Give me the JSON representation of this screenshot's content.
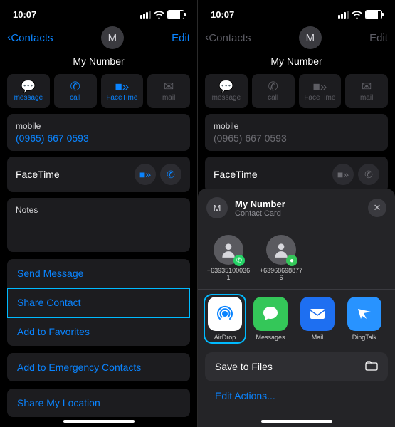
{
  "left": {
    "status_time": "10:07",
    "nav": {
      "back": "Contacts",
      "avatar_letter": "M",
      "edit": "Edit"
    },
    "contact_name": "My Number",
    "actions": {
      "message": "message",
      "call": "call",
      "facetime": "FaceTime",
      "mail": "mail"
    },
    "mobile": {
      "label": "mobile",
      "value": "(0965) 667 0593"
    },
    "facetime_label": "FaceTime",
    "notes_label": "Notes",
    "links1": {
      "send_message": "Send Message",
      "share_contact": "Share Contact",
      "add_favorites": "Add to Favorites"
    },
    "links2": {
      "add_emergency": "Add to Emergency Contacts"
    },
    "links3": {
      "share_location": "Share My Location"
    }
  },
  "right": {
    "status_time": "10:07",
    "nav": {
      "back": "Contacts",
      "avatar_letter": "M",
      "edit": "Edit"
    },
    "contact_name": "My Number",
    "actions": {
      "message": "message",
      "call": "call",
      "facetime": "FaceTime",
      "mail": "mail"
    },
    "mobile": {
      "label": "mobile",
      "value": "(0965) 667 0593"
    },
    "facetime_label": "FaceTime",
    "sheet": {
      "avatar_letter": "M",
      "title": "My Number",
      "subtitle": "Contact Card",
      "people": [
        {
          "number": "+639351000361"
        },
        {
          "number": "+639686988776"
        }
      ],
      "apps": {
        "airdrop": "AirDrop",
        "messages": "Messages",
        "mail": "Mail",
        "dingtalk": "DingTalk"
      },
      "save_to_files": "Save to Files",
      "edit_actions": "Edit Actions..."
    }
  }
}
